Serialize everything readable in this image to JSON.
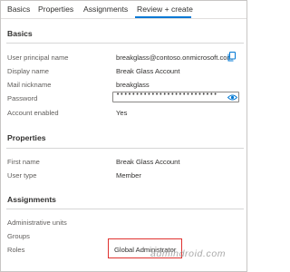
{
  "tabs": [
    {
      "label": "Basics"
    },
    {
      "label": "Properties"
    },
    {
      "label": "Assignments"
    },
    {
      "label": "Review + create",
      "active": true
    }
  ],
  "sections": {
    "basics": {
      "title": "Basics",
      "rows": [
        {
          "label": "User principal name",
          "value": "breakglass@contoso.onmicrosoft.com"
        },
        {
          "label": "Display name",
          "value": "Break Glass Account"
        },
        {
          "label": "Mail nickname",
          "value": "breakglass"
        },
        {
          "label": "Password",
          "value": "••••••••••••••••••••••••••"
        },
        {
          "label": "Account enabled",
          "value": "Yes"
        }
      ]
    },
    "properties": {
      "title": "Properties",
      "rows": [
        {
          "label": "First name",
          "value": "Break Glass Account"
        },
        {
          "label": "User type",
          "value": "Member"
        }
      ]
    },
    "assignments": {
      "title": "Assignments",
      "rows": [
        {
          "label": "Administrative units",
          "value": ""
        },
        {
          "label": "Groups",
          "value": ""
        },
        {
          "label": "Roles",
          "value": "Global Administrator"
        }
      ]
    }
  },
  "watermark": "admindroid.com",
  "colors": {
    "accent": "#0078d4",
    "highlight": "#e0322f"
  },
  "icons": {
    "copy": "copy-icon",
    "show_password": "eye-icon"
  }
}
